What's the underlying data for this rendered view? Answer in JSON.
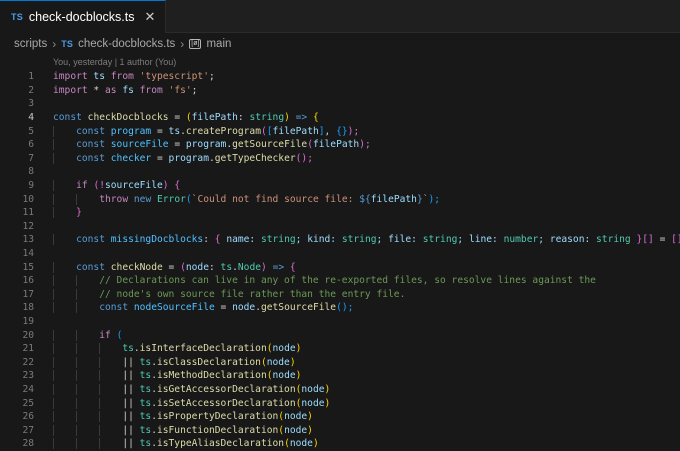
{
  "tab": {
    "icon_label": "TS",
    "title": "check-docblocks.ts"
  },
  "breadcrumb": {
    "folder": "scripts",
    "file_icon": "TS",
    "file": "check-docblocks.ts",
    "symbol_icon": "[ø]",
    "symbol": "main"
  },
  "blame": "You, yesterday | 1 author (You)",
  "lines": {
    "l1": [
      "1",
      "import",
      " ts ",
      "from",
      " ",
      "'typescript'",
      ";"
    ],
    "l2": [
      "2",
      "import",
      " * ",
      "as",
      " fs ",
      "from",
      " ",
      "'fs'",
      ";"
    ],
    "l3": [
      "3"
    ],
    "l4": [
      "4",
      "const",
      " ",
      "checkDocblocks",
      " = ",
      "(",
      "filePath",
      ": ",
      "string",
      ") ",
      "=>",
      " ",
      "{"
    ],
    "l5": [
      "5",
      "const",
      " ",
      "program",
      " = ",
      "ts",
      ".",
      "createProgram",
      "(",
      "[",
      "filePath",
      "]",
      ", ",
      "{}",
      ");"
    ],
    "l6": [
      "6",
      "const",
      " ",
      "sourceFile",
      " = ",
      "program",
      ".",
      "getSourceFile",
      "(",
      "filePath",
      ");"
    ],
    "l7": [
      "7",
      "const",
      " ",
      "checker",
      " = ",
      "program",
      ".",
      "getTypeChecker",
      "();"
    ],
    "l8": [
      "8"
    ],
    "l9": [
      "9",
      "if",
      " (!",
      "sourceFile",
      ") ",
      "{"
    ],
    "l10": [
      "10",
      "throw",
      " ",
      "new",
      " ",
      "Error",
      "(",
      "`Could not find source file: ",
      "${",
      "filePath",
      "}",
      "`",
      ");"
    ],
    "l11": [
      "11",
      "}"
    ],
    "l12": [
      "12"
    ],
    "l13": [
      "13",
      "const",
      " ",
      "missingDocblocks",
      ": ",
      "{",
      " name: ",
      "string",
      "; kind: ",
      "string",
      "; file: ",
      "string",
      "; line: ",
      "number",
      "; reason: ",
      "string",
      " ",
      "}",
      "[]",
      " = ",
      "[]",
      ";"
    ],
    "l14": [
      "14"
    ],
    "l15": [
      "15",
      "const",
      " ",
      "checkNode",
      " = ",
      "(",
      "node",
      ": ",
      "ts",
      ".",
      "Node",
      ") ",
      "=>",
      " ",
      "{"
    ],
    "l16": [
      "16",
      "// Declarations can live in any of the re-exported files, so resolve lines against the"
    ],
    "l17": [
      "17",
      "// node's own source file rather than the entry file."
    ],
    "l18": [
      "18",
      "const",
      " ",
      "nodeSourceFile",
      " = ",
      "node",
      ".",
      "getSourceFile",
      "();"
    ],
    "l19": [
      "19"
    ],
    "l20": [
      "20",
      "if",
      " ",
      "("
    ],
    "l21": [
      "21",
      "ts",
      ".",
      "isInterfaceDeclaration",
      "(",
      "node",
      ")"
    ],
    "l22": [
      "22",
      "|| ",
      "ts",
      ".",
      "isClassDeclaration",
      "(",
      "node",
      ")"
    ],
    "l23": [
      "23",
      "|| ",
      "ts",
      ".",
      "isMethodDeclaration",
      "(",
      "node",
      ")"
    ],
    "l24": [
      "24",
      "|| ",
      "ts",
      ".",
      "isGetAccessorDeclaration",
      "(",
      "node",
      ")"
    ],
    "l25": [
      "25",
      "|| ",
      "ts",
      ".",
      "isSetAccessorDeclaration",
      "(",
      "node",
      ")"
    ],
    "l26": [
      "26",
      "|| ",
      "ts",
      ".",
      "isPropertyDeclaration",
      "(",
      "node",
      ")"
    ],
    "l27": [
      "27",
      "|| ",
      "ts",
      ".",
      "isFunctionDeclaration",
      "(",
      "node",
      ")"
    ],
    "l28": [
      "28",
      "|| ",
      "ts",
      ".",
      "isTypeAliasDeclaration",
      "(",
      "node",
      ")"
    ]
  },
  "colors": {
    "background": "#181818",
    "tab_accent": "#0078d4",
    "keyword": "#c586c0",
    "storage": "#569cd6",
    "variable": "#9cdcfe",
    "function": "#dcdcaa",
    "string": "#ce9178",
    "type": "#4ec9b0",
    "comment": "#6a9955"
  }
}
